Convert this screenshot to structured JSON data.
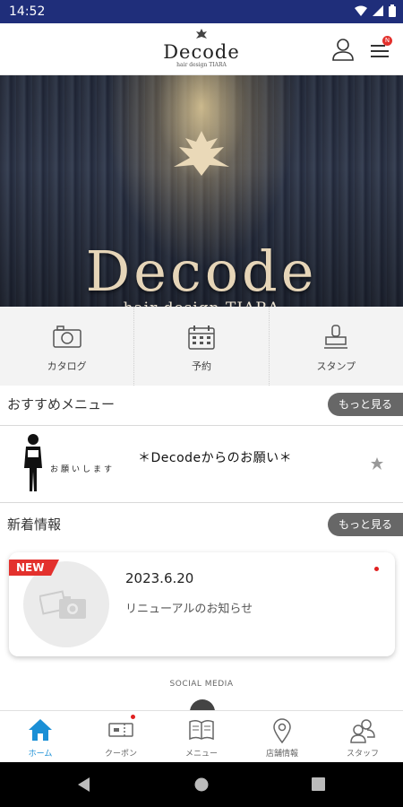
{
  "status": {
    "time": "14:52"
  },
  "header": {
    "logo_text": "Decode",
    "logo_sub": "hair design TIARA",
    "badge": "N"
  },
  "hero": {
    "title": "Decode",
    "subtitle": "hair design TIARA"
  },
  "quick_menu": [
    {
      "label": "カタログ",
      "icon": "camera-icon"
    },
    {
      "label": "予約",
      "icon": "calendar-icon"
    },
    {
      "label": "スタンプ",
      "icon": "stamp-icon"
    }
  ],
  "recommended": {
    "title": "おすすめメニュー",
    "more_label": "もっと見る",
    "item": {
      "title": "＊Decodeからのお願い＊",
      "thumb_caption": "お願いします"
    }
  },
  "news": {
    "title": "新着情報",
    "more_label": "もっと見る",
    "item": {
      "badge": "NEW",
      "date": "2023.6.20",
      "text": "リニューアルのお知らせ"
    }
  },
  "social": {
    "label": "SOCIAL MEDIA"
  },
  "tabs": [
    {
      "label": "ホーム",
      "icon": "home-icon",
      "active": true
    },
    {
      "label": "クーポン",
      "icon": "coupon-icon",
      "active": false
    },
    {
      "label": "メニュー",
      "icon": "book-icon",
      "active": false
    },
    {
      "label": "店舗情報",
      "icon": "map-pin-icon",
      "active": false
    },
    {
      "label": "スタッフ",
      "icon": "people-icon",
      "active": false
    }
  ],
  "colors": {
    "status_bar": "#1f2e7a",
    "accent": "#1a8fd6",
    "badge_red": "#e3312d",
    "more_button": "#676767"
  }
}
